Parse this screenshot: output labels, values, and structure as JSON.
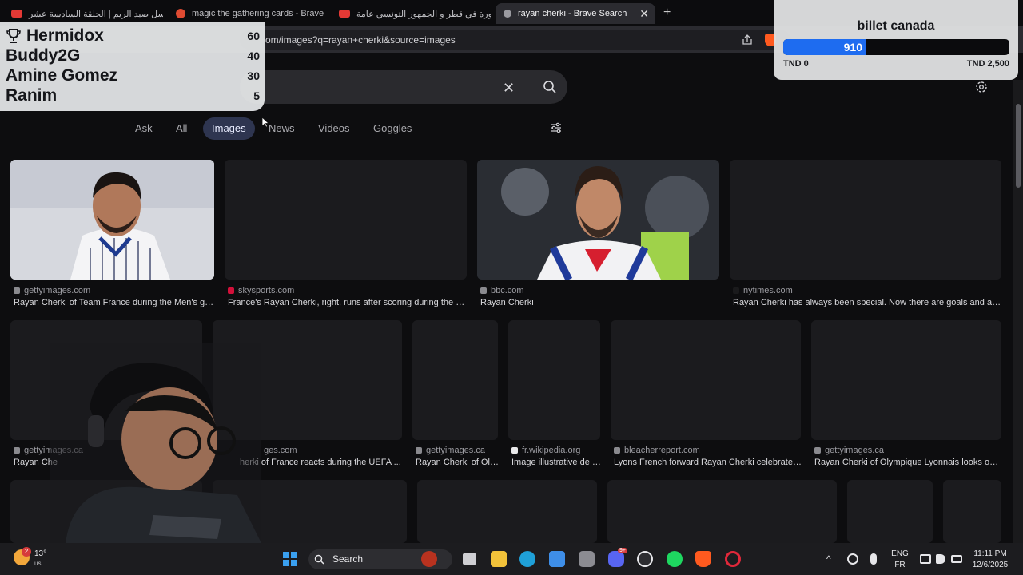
{
  "browser": {
    "tabs": [
      {
        "label": "مسلسل صيد الريم | الحلقة السادسة عشر",
        "favicon_color": "#e53935"
      },
      {
        "label": "magic the gathering cards - Brave Search",
        "favicon_color": "#e04b32"
      },
      {
        "label": "دورة في قطر و الجمهور التونسي عامة",
        "favicon_color": "#e53935"
      },
      {
        "label": "rayan cherki - Brave Search",
        "favicon_color": "#9a9aa0"
      }
    ],
    "new_tab_symbol": "+",
    "close_symbol": "✕",
    "url": "om/images?q=rayan+cherki&source=images"
  },
  "search": {
    "clear_symbol": "✕",
    "filter_tabs": [
      "Ask",
      "All",
      "Images",
      "News",
      "Videos",
      "Goggles"
    ],
    "active_filter": "Images"
  },
  "results": {
    "row1": [
      {
        "source": "gettyimages.com",
        "caption": "Rayan Cherki of Team France during the Men's gro..."
      },
      {
        "source": "skysports.com",
        "caption": "France's Rayan Cherki, right, runs after scoring during the Na..."
      },
      {
        "source": "bbc.com",
        "caption": "Rayan Cherki"
      },
      {
        "source": "nytimes.com",
        "caption": "Rayan Cherki has always been special. Now there are goals and assis..."
      }
    ],
    "row2": [
      {
        "source": "gettyimages.ca",
        "caption": "Rayan Che"
      },
      {
        "source": "ges.com",
        "caption": "herki of France reacts during the UEFA ..."
      },
      {
        "source": "gettyimages.ca",
        "caption": "Rayan Cherki of Oly..."
      },
      {
        "source": "fr.wikipedia.org",
        "caption": "Image illustrative de l'..."
      },
      {
        "source": "bleacherreport.com",
        "caption": "Lyons French forward Rayan Cherki celebrates ..."
      },
      {
        "source": "gettyimages.ca",
        "caption": "Rayan Cherki of Olympique Lyonnais looks on d..."
      }
    ]
  },
  "leaderboard": [
    {
      "name": "Hermidox",
      "score": "60",
      "icon": "trophy-icon"
    },
    {
      "name": "Buddy2G",
      "score": "40"
    },
    {
      "name": "Amine Gomez",
      "score": "30"
    },
    {
      "name": "Ranim",
      "score": "5"
    }
  ],
  "goal": {
    "title": "billet canada",
    "current": "910",
    "min_label": "TND 0",
    "max_label": "TND 2,500",
    "progress": 0.364,
    "fill_color": "#1e6cf0"
  },
  "taskbar": {
    "weather_temp": "13°",
    "weather_badge": "2",
    "weather_sub": "us",
    "search_label": "Search",
    "lang_top": "ENG",
    "lang_bottom": "FR",
    "time": "11:11 PM",
    "date": "12/6/2025",
    "discord_badge": "9+"
  }
}
